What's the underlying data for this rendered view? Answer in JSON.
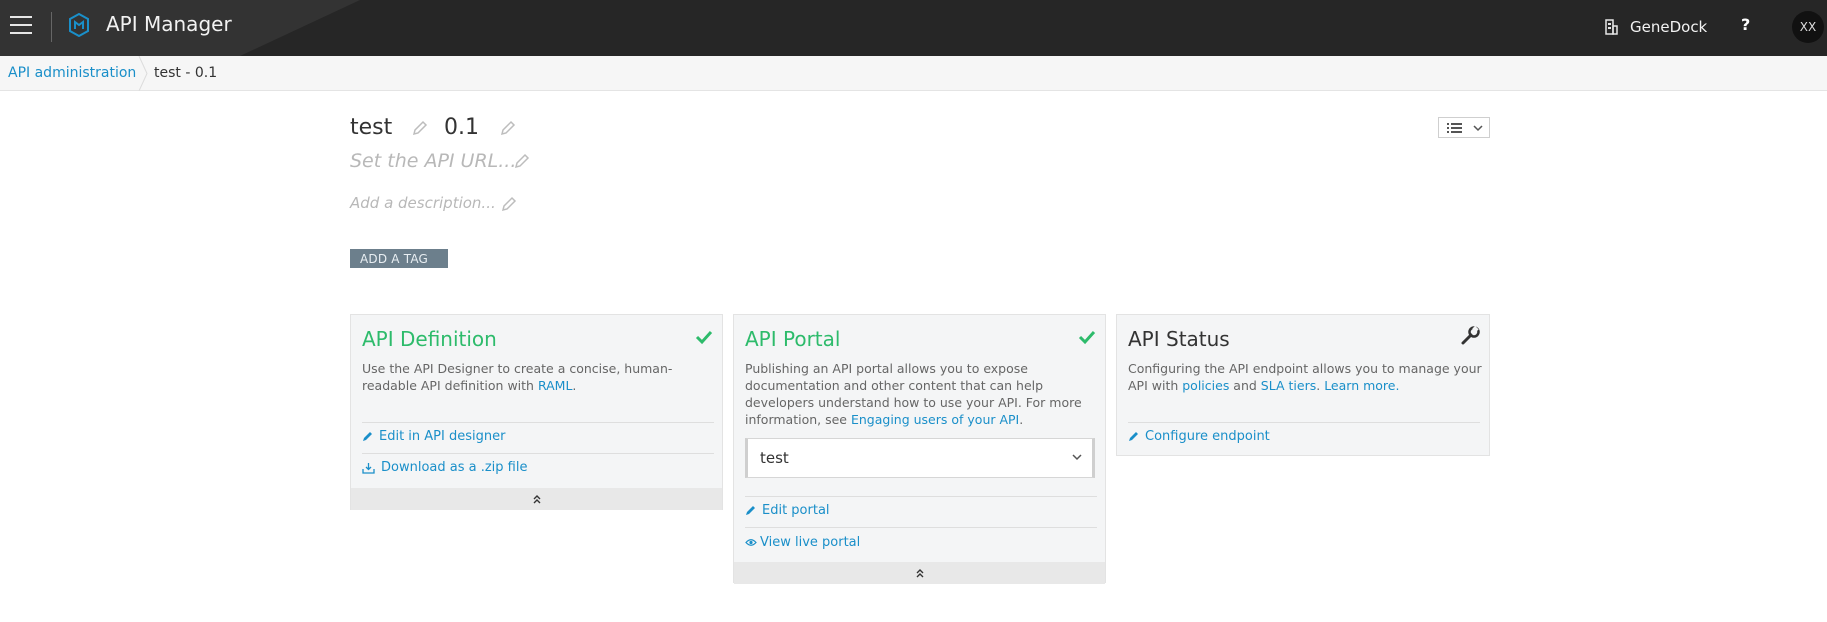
{
  "app": {
    "title": "API Manager",
    "org_name": "GeneDock",
    "help_label": "?",
    "user_initials": "XX"
  },
  "breadcrumb": {
    "root": "API administration",
    "current": "test - 0.1"
  },
  "api": {
    "name": "test",
    "version": "0.1",
    "url_placeholder": "Set the API URL...",
    "description_placeholder": "Add a description...",
    "add_tag_label": "ADD A TAG"
  },
  "cards": {
    "definition": {
      "title": "API Definition",
      "text_before": "Use the API Designer to create a concise, human-readable API definition with ",
      "text_link": "RAML",
      "text_after": ".",
      "links": [
        "Edit in API designer",
        "Download as a .zip file"
      ]
    },
    "portal": {
      "title": "API Portal",
      "text_before": "Publishing an API portal allows you to expose documentation and other content that can help developers understand how to use your API. For more information, see ",
      "text_link": "Engaging users of your API",
      "text_after": ".",
      "select_value": "test",
      "links": [
        "Edit portal",
        "View live portal"
      ]
    },
    "status": {
      "title": "API Status",
      "text_before": "Configuring the API endpoint allows you to manage your API with ",
      "link_policies": "policies",
      "text_and": " and ",
      "link_sla": "SLA tiers",
      "text_dot": ". ",
      "link_learn": "Learn more.",
      "links": [
        "Configure endpoint"
      ]
    }
  },
  "colors": {
    "accent_green": "#2dbb6b",
    "link_blue": "#1a8fc9",
    "topbar": "#262626"
  }
}
